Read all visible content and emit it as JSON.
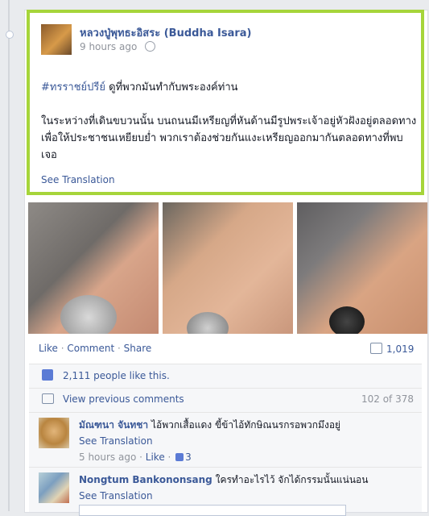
{
  "post": {
    "author": "หลวงปู่พุทธะอิสระ (Buddha Isara)",
    "time": "9 hours ago",
    "hashtag": "#ทรราชย์ปรีย์",
    "headline_rest": " ดูที่พวกมันทำกับพระองค์ท่าน",
    "body": "ในระหว่างที่เดินขบวนนั้น บนถนนมีเหรียญที่หันด้านมีรูปพระเจ้าอยู่หัวฝังอยู่ตลอดทาง เพื่อให้ประชาชนเหยียบย่ำ พวกเราต้องช่วยกันแงะเหรียญออกมากันตลอดทางที่พบเจอ",
    "see_translation": "See Translation"
  },
  "actions": {
    "like": "Like",
    "comment": "Comment",
    "share": "Share",
    "sep": " · ",
    "comment_count": "1,019"
  },
  "likes": {
    "text": "2,111 people like this."
  },
  "comments_nav": {
    "prev": "View previous comments",
    "count": "102 of 378"
  },
  "comments": [
    {
      "name": "มัณฑนา จันทชา",
      "text": " ไอ้พวกเสื้อแดง ขี้ข้าไอ้ทักษิณนรกรอพวกมึงอยู่",
      "see_translation": "See Translation",
      "time": "5 hours ago",
      "like": "Like",
      "likes": "3"
    },
    {
      "name": "Nongtum Bankononsang",
      "text": " ใครทำอะไรไว้ จักได้กรรมนั้นแน่นอน",
      "see_translation": "See Translation"
    }
  ],
  "icons": [
    "globe-icon",
    "comment-icon",
    "thumbs-up-icon",
    "speech-bubble-icon"
  ],
  "colors": {
    "highlight": "#a6d53a",
    "link": "#3b5998"
  }
}
